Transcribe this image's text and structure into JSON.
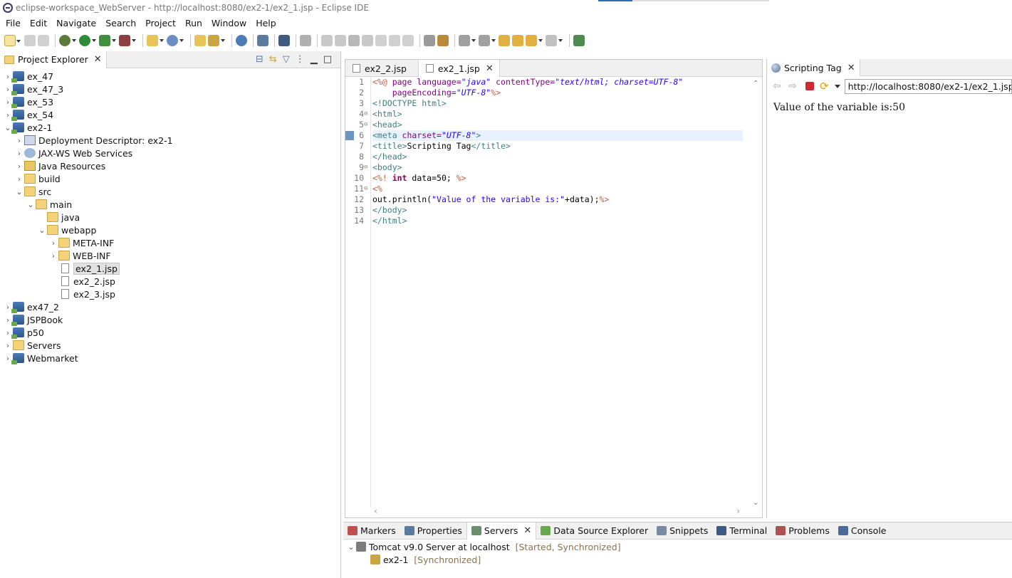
{
  "window": {
    "title": "eclipse-workspace_WebServer - http://localhost:8080/ex2-1/ex2_1.jsp - Eclipse IDE"
  },
  "menu": [
    "File",
    "Edit",
    "Navigate",
    "Search",
    "Project",
    "Run",
    "Window",
    "Help"
  ],
  "project_explorer": {
    "tab_label": "Project Explorer",
    "items": [
      {
        "label": "ex_47"
      },
      {
        "label": "ex_47_3"
      },
      {
        "label": "ex_53"
      },
      {
        "label": "ex_54"
      },
      {
        "label": "ex2-1"
      },
      {
        "label": "Deployment Descriptor: ex2-1"
      },
      {
        "label": "JAX-WS Web Services"
      },
      {
        "label": "Java Resources"
      },
      {
        "label": "build"
      },
      {
        "label": "src"
      },
      {
        "label": "main"
      },
      {
        "label": "java"
      },
      {
        "label": "webapp"
      },
      {
        "label": "META-INF"
      },
      {
        "label": "WEB-INF"
      },
      {
        "label": "ex2_1.jsp"
      },
      {
        "label": "ex2_2.jsp"
      },
      {
        "label": "ex2_3.jsp"
      },
      {
        "label": "ex47_2"
      },
      {
        "label": "JSPBook"
      },
      {
        "label": "p50"
      },
      {
        "label": "Servers"
      },
      {
        "label": "Webmarket"
      }
    ]
  },
  "editor": {
    "tabs": [
      {
        "label": "ex2_2.jsp"
      },
      {
        "label": "ex2_1.jsp"
      }
    ],
    "line_numbers": [
      "1",
      "2",
      "3",
      "4",
      "5",
      "6",
      "7",
      "8",
      "9",
      "10",
      "11",
      "12",
      "13",
      "14"
    ],
    "code": {
      "l1_a": "<%@ ",
      "l1_b": "page ",
      "l1_c": "language=",
      "l1_d": "\"java\"",
      "l1_e": " contentType=",
      "l1_f": "\"text/html; charset=UTF-8\"",
      "l2_a": "    pageEncoding=",
      "l2_b": "\"UTF-8\"",
      "l2_c": "%>",
      "l3": "<!DOCTYPE html>",
      "l4": "<html>",
      "l5": "<head>",
      "l6_a": "<meta ",
      "l6_b": "charset=",
      "l6_c": "\"UTF-8\"",
      "l6_d": ">",
      "l7_a": "<title>",
      "l7_b": "Scripting Tag",
      "l7_c": "</title>",
      "l8": "</head>",
      "l9": "<body>",
      "l10_a": "<%! ",
      "l10_b": "int",
      "l10_c": " data=50; ",
      "l10_d": "%>",
      "l11": "<%",
      "l12_a": "out.println(",
      "l12_b": "\"Value of the variable is:\"",
      "l12_c": "+data);",
      "l12_d": "%>",
      "l13": "</body>",
      "l14": "</html>"
    }
  },
  "browser": {
    "tab_label": "Scripting Tag",
    "url": "http://localhost:8080/ex2-1/ex2_1.jsp",
    "content": "Value of the variable is:50"
  },
  "bottom_panel": {
    "tabs": [
      {
        "label": "Markers"
      },
      {
        "label": "Properties"
      },
      {
        "label": "Servers"
      },
      {
        "label": "Data Source Explorer"
      },
      {
        "label": "Snippets"
      },
      {
        "label": "Terminal"
      },
      {
        "label": "Problems"
      },
      {
        "label": "Console"
      }
    ],
    "server": {
      "name": "Tomcat v9.0 Server at localhost",
      "status": "[Started, Synchronized]"
    },
    "module": {
      "name": "ex2-1",
      "status": "[Synchronized]"
    }
  },
  "icons": {
    "close": "close-icon",
    "chevron_right": "chevron-right-icon",
    "chevron_down": "chevron-down-icon"
  }
}
